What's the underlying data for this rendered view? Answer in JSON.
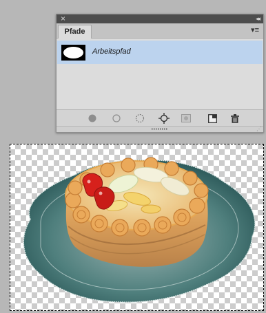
{
  "panel": {
    "close_label": "×",
    "collapse_label": "◂◂",
    "tab_label": "Pfade",
    "menu_label": "▾≡",
    "path_name": "Arbeitspfad"
  },
  "toolbar": {
    "icons": [
      "fill-path-icon",
      "stroke-path-icon",
      "load-selection-icon",
      "make-work-path-icon",
      "add-mask-icon",
      "new-path-icon",
      "delete-path-icon"
    ]
  },
  "colors": {
    "panel_bg": "#dcdcdc",
    "selected_row": "#bcd3ee",
    "titlebar": "#4d4d4d",
    "workspace": "#b7b7b7"
  },
  "canvas": {
    "content": "cake-on-glass-plate-with-transparent-background"
  }
}
